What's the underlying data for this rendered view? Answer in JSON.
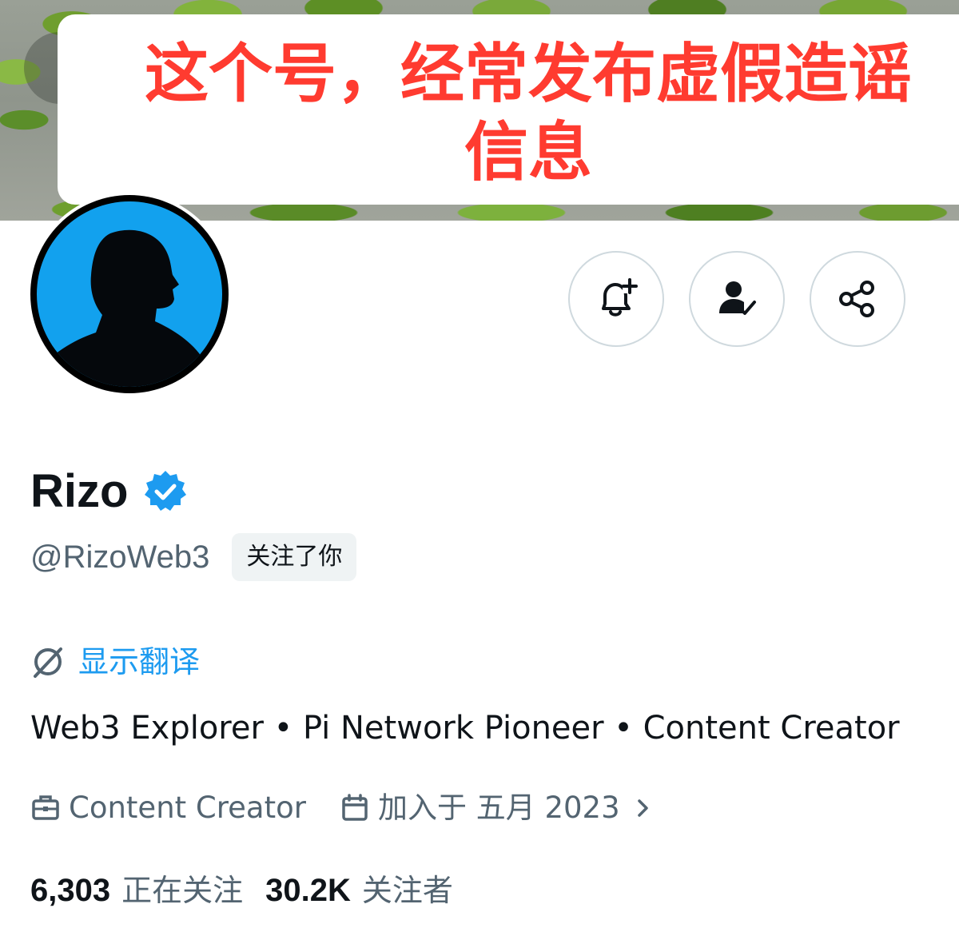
{
  "banner": {
    "overlay_line1": "这个号，经常发布虚假造谣",
    "overlay_line2": "信息",
    "overlay_color": "#ff3b30"
  },
  "profile": {
    "display_name": "Rizo",
    "handle": "@RizoWeb3",
    "follows_you_badge": "关注了你",
    "verified": true,
    "verified_color": "#1d9bf0"
  },
  "actions": {
    "notify_icon": "bell-plus-icon",
    "following_icon": "person-check-icon",
    "share_icon": "share-icon"
  },
  "translate": {
    "label": "显示翻译",
    "icon": "translate-globe-icon"
  },
  "bio": "Web3 Explorer • Pi Network Pioneer • Content Creator",
  "meta": {
    "category": "Content Creator",
    "category_icon": "briefcase-icon",
    "joined": "加入于 五月 2023",
    "joined_icon": "calendar-icon"
  },
  "stats": {
    "following_count": "6,303",
    "following_label": "正在关注",
    "followers_count": "30.2K",
    "followers_label": "关注者"
  }
}
